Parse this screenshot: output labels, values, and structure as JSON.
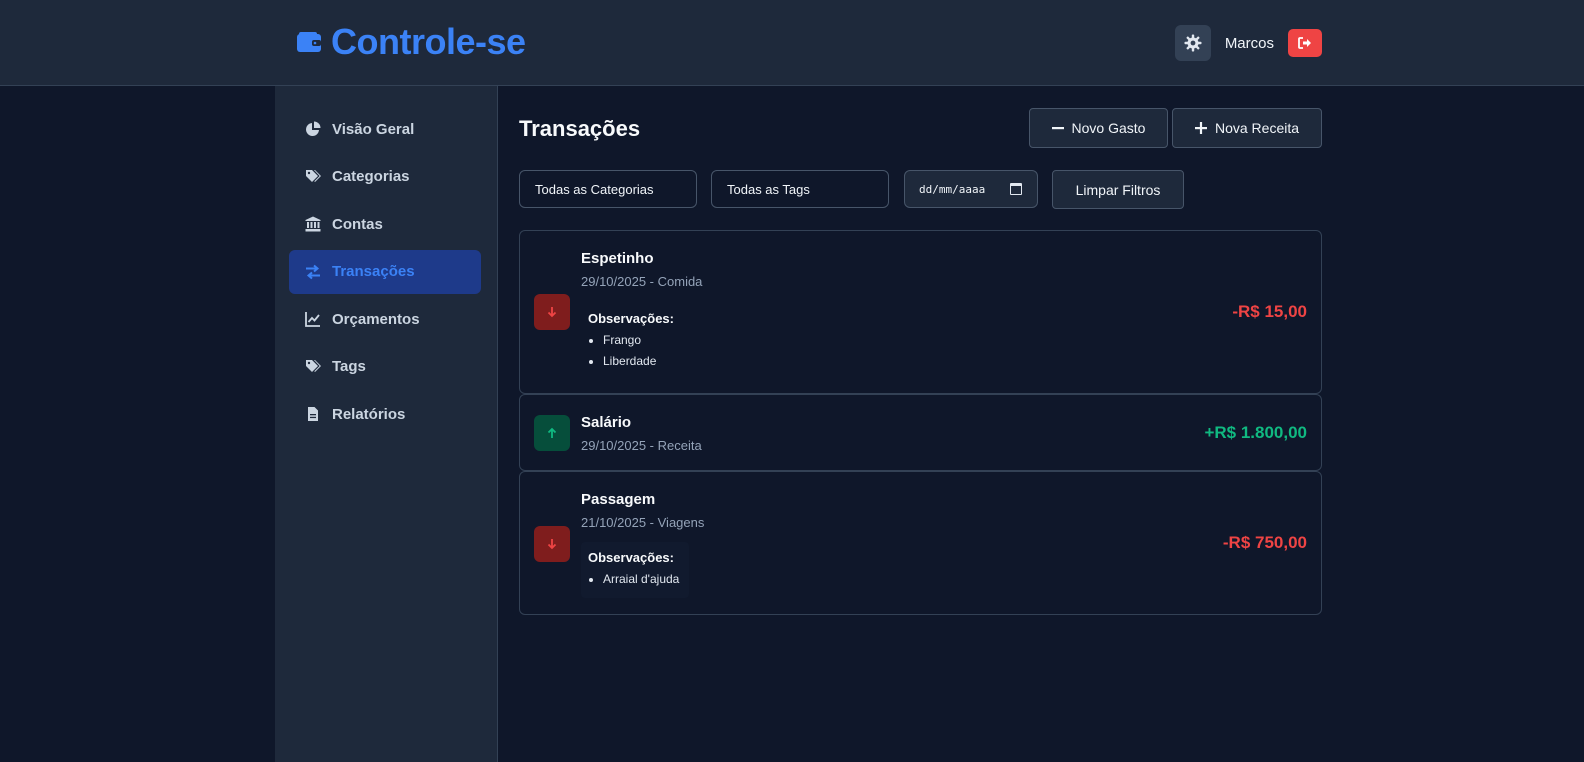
{
  "app": {
    "title": "Controle-se"
  },
  "user": {
    "name": "Marcos"
  },
  "colors": {
    "accent": "#3b82f6",
    "expense": "#ef4444",
    "income": "#10b981",
    "background": "#0f172a",
    "panel": "#1e293b"
  },
  "sidebar": {
    "items": [
      {
        "label": "Visão Geral",
        "icon": "pie-chart-icon",
        "active": false
      },
      {
        "label": "Categorias",
        "icon": "tags-icon",
        "active": false
      },
      {
        "label": "Contas",
        "icon": "bank-icon",
        "active": false
      },
      {
        "label": "Transações",
        "icon": "exchange-icon",
        "active": true
      },
      {
        "label": "Orçamentos",
        "icon": "line-chart-icon",
        "active": false
      },
      {
        "label": "Tags",
        "icon": "tags-icon",
        "active": false
      },
      {
        "label": "Relatórios",
        "icon": "file-icon",
        "active": false
      }
    ]
  },
  "main": {
    "title": "Transações",
    "new_expense_label": "Novo Gasto",
    "new_income_label": "Nova Receita"
  },
  "filters": {
    "category": "Todas as Categorias",
    "tag": "Todas as Tags",
    "date_placeholder": "dd/mm/aaaa",
    "clear_label": "Limpar Filtros"
  },
  "transactions": [
    {
      "name": "Espetinho",
      "meta": "29/10/2025 - Comida",
      "type": "expense",
      "amount": "-R$ 15,00",
      "notes_title": "Observações:",
      "notes": [
        "Frango",
        "Liberdade"
      ]
    },
    {
      "name": "Salário",
      "meta": "29/10/2025 - Receita",
      "type": "income",
      "amount": "+R$ 1.800,00"
    },
    {
      "name": "Passagem",
      "meta": "21/10/2025 - Viagens",
      "type": "expense",
      "amount": "-R$ 750,00",
      "notes_title": "Observações:",
      "notes": [
        "Arraial d'ajuda"
      ]
    }
  ]
}
